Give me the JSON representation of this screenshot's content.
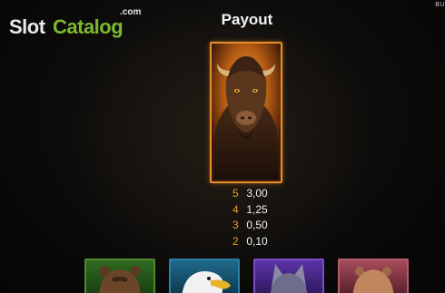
{
  "logo": {
    "part1": "Slot",
    "part2": "Catalog",
    "suffix": ".com"
  },
  "corner_text": "BU",
  "title": "Payout",
  "main_symbol": {
    "name": "bison-icon",
    "frame_color": "#e8902a"
  },
  "paytable": [
    {
      "count": "5",
      "value": "3,00"
    },
    {
      "count": "4",
      "value": "1,25"
    },
    {
      "count": "3",
      "value": "0,50"
    },
    {
      "count": "2",
      "value": "0,10"
    }
  ],
  "colors": {
    "count_color": "#e6a21a",
    "value_color": "#f1f1f1",
    "logo_accent": "#7cb82f"
  },
  "symbol_strip": [
    {
      "icon": "bear-icon",
      "frame_color": "#4d8a2b"
    },
    {
      "icon": "eagle-icon",
      "frame_color": "#2a7fa8"
    },
    {
      "icon": "wolf-icon",
      "frame_color": "#7a4cc9"
    },
    {
      "icon": "cougar-icon",
      "frame_color": "#b55a6a"
    }
  ]
}
